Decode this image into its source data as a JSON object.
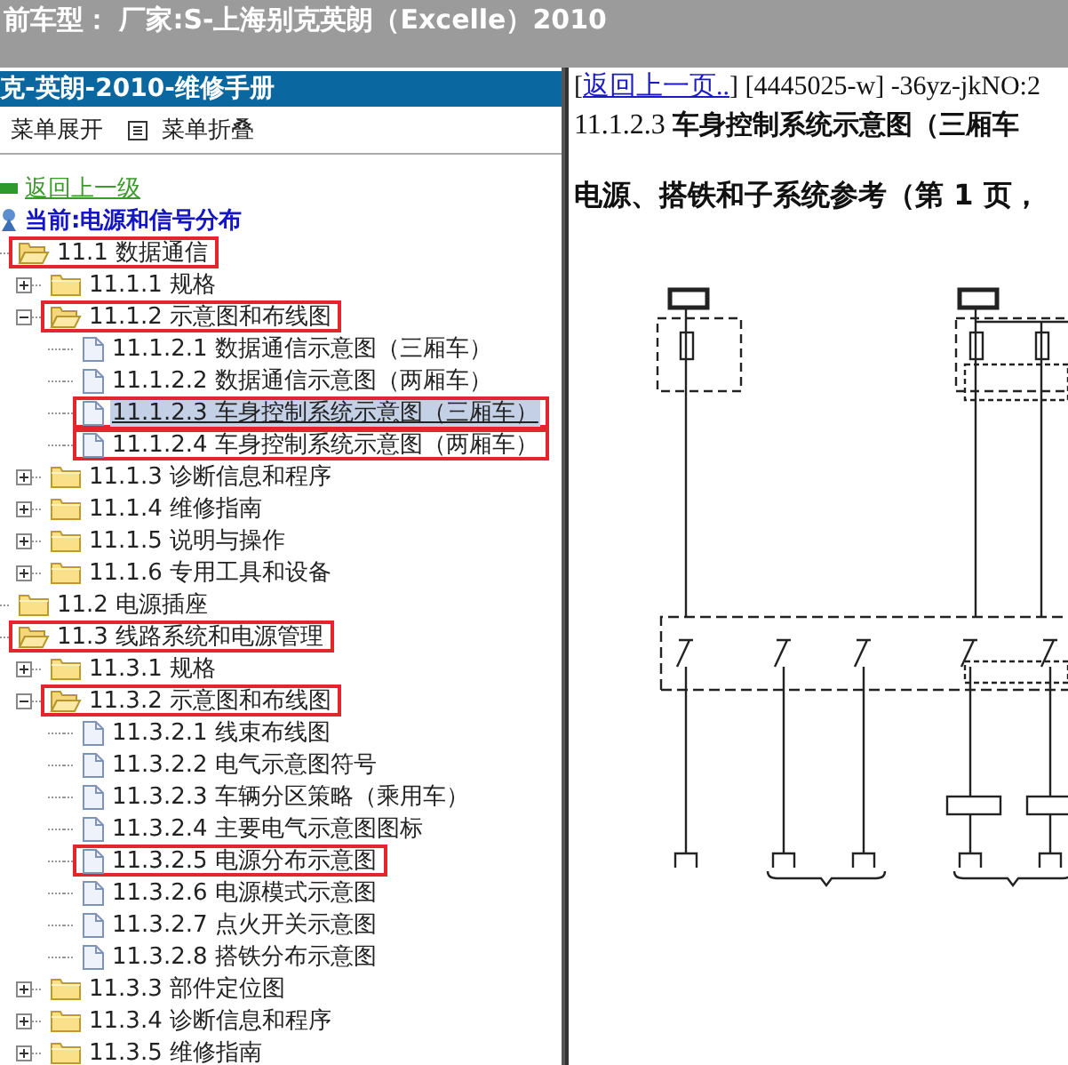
{
  "header": {
    "title": "前车型：  厂家:S-上海别克英朗（Excelle）2010"
  },
  "sidebar": {
    "title": "克-英朗-2010-维修手册",
    "toolbar": [
      {
        "label": "菜单展开",
        "icon": false
      },
      {
        "label": "菜单折叠",
        "icon": true
      }
    ],
    "back_link": "返回上一级",
    "current": "当前:电源和信号分布",
    "tree": [
      {
        "label": "11.1 数据通信",
        "kind": "folder",
        "expanded": true,
        "selected": false,
        "outlined": true,
        "children": [
          {
            "label": "11.1.1 规格",
            "kind": "folder",
            "expanded": false,
            "selected": false,
            "outlined": false
          },
          {
            "label": "11.1.2 示意图和布线图",
            "kind": "folder",
            "expanded": true,
            "selected": false,
            "outlined": true,
            "children": [
              {
                "label": "11.1.2.1 数据通信示意图（三厢车）",
                "kind": "page",
                "selected": false,
                "outlined": false
              },
              {
                "label": "11.1.2.2 数据通信示意图（两厢车）",
                "kind": "page",
                "selected": false,
                "outlined": false
              },
              {
                "label": "11.1.2.3 车身控制系统示意图（三厢车）",
                "kind": "page",
                "selected": true,
                "outlined": true
              },
              {
                "label": "11.1.2.4 车身控制系统示意图（两厢车）",
                "kind": "page",
                "selected": false,
                "outlined": true
              }
            ]
          },
          {
            "label": "11.1.3 诊断信息和程序",
            "kind": "folder",
            "expanded": false,
            "selected": false,
            "outlined": false
          },
          {
            "label": "11.1.4 维修指南",
            "kind": "folder",
            "expanded": false,
            "selected": false,
            "outlined": false
          },
          {
            "label": "11.1.5 说明与操作",
            "kind": "folder",
            "expanded": false,
            "selected": false,
            "outlined": false
          },
          {
            "label": "11.1.6 专用工具和设备",
            "kind": "folder",
            "expanded": false,
            "selected": false,
            "outlined": false
          }
        ]
      },
      {
        "label": "11.2 电源插座",
        "kind": "folder",
        "expanded": false,
        "selected": false,
        "outlined": false
      },
      {
        "label": "11.3 线路系统和电源管理",
        "kind": "folder",
        "expanded": true,
        "selected": false,
        "outlined": true,
        "children": [
          {
            "label": "11.3.1 规格",
            "kind": "folder",
            "expanded": false,
            "selected": false,
            "outlined": false
          },
          {
            "label": "11.3.2 示意图和布线图",
            "kind": "folder",
            "expanded": true,
            "selected": false,
            "outlined": true,
            "children": [
              {
                "label": "11.3.2.1 线束布线图",
                "kind": "page",
                "selected": false,
                "outlined": false
              },
              {
                "label": "11.3.2.2 电气示意图符号",
                "kind": "page",
                "selected": false,
                "outlined": false
              },
              {
                "label": "11.3.2.3 车辆分区策略（乘用车）",
                "kind": "page",
                "selected": false,
                "outlined": false
              },
              {
                "label": "11.3.2.4 主要电气示意图图标",
                "kind": "page",
                "selected": false,
                "outlined": false
              },
              {
                "label": "11.3.2.5 电源分布示意图",
                "kind": "page",
                "selected": false,
                "outlined": true
              },
              {
                "label": "11.3.2.6 电源模式示意图",
                "kind": "page",
                "selected": false,
                "outlined": false
              },
              {
                "label": "11.3.2.7 点火开关示意图",
                "kind": "page",
                "selected": false,
                "outlined": false
              },
              {
                "label": "11.3.2.8 搭铁分布示意图",
                "kind": "page",
                "selected": false,
                "outlined": false
              }
            ]
          },
          {
            "label": "11.3.3 部件定位图",
            "kind": "folder",
            "expanded": false,
            "selected": false,
            "outlined": false
          },
          {
            "label": "11.3.4 诊断信息和程序",
            "kind": "folder",
            "expanded": false,
            "selected": false,
            "outlined": false
          },
          {
            "label": "11.3.5 维修指南",
            "kind": "folder",
            "expanded": false,
            "selected": false,
            "outlined": false
          }
        ]
      }
    ]
  },
  "document": {
    "nav_prefix": "[",
    "back_link": "返回上一页..",
    "nav_suffix": "] [4445025-w] -36yz-jkNO:2",
    "title": "11.1.2.3 **车身控制系统示意图（三厢车**",
    "heading": "电源、搭铁和子系统参考（第 1 页，"
  }
}
